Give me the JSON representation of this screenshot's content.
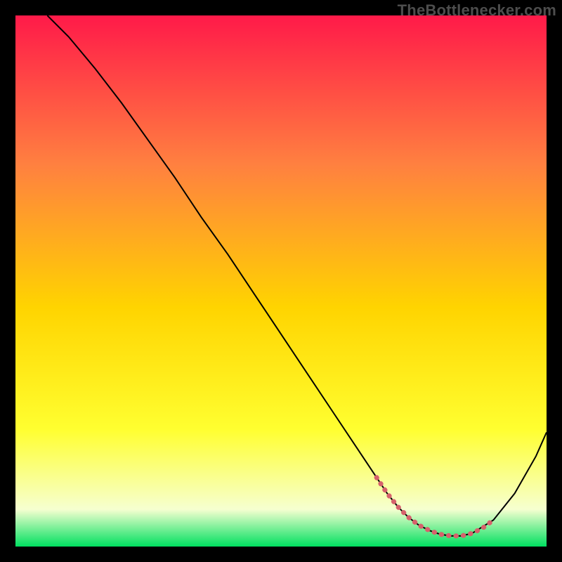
{
  "watermark": "TheBottlenecker.com",
  "chart_data": {
    "type": "line",
    "title": "",
    "xlabel": "",
    "ylabel": "",
    "xlim": [
      0,
      100
    ],
    "ylim": [
      0,
      100
    ],
    "grid": false,
    "gradient": {
      "top": "#ff1a49",
      "upper_mid": "#ff8040",
      "mid": "#ffd400",
      "lower_mid": "#ffff30",
      "near_bottom": "#f6ffd0",
      "bottom": "#00e060"
    },
    "series": [
      {
        "name": "curve",
        "color": "#000000",
        "stroke_width": 2,
        "x": [
          6,
          10,
          15,
          20,
          25,
          30,
          35,
          40,
          45,
          50,
          55,
          60,
          65,
          68,
          70,
          72,
          74,
          76,
          78,
          80,
          82,
          84,
          86,
          90,
          94,
          98,
          100
        ],
        "y": [
          100,
          96,
          90,
          83.5,
          76.5,
          69.5,
          62,
          55,
          47.5,
          40,
          32.5,
          25,
          17.5,
          13,
          10,
          7.5,
          5.5,
          4,
          3,
          2.3,
          2,
          2,
          2.5,
          5,
          10,
          17,
          21.5
        ]
      },
      {
        "name": "highlight",
        "color": "#d6626c",
        "stroke_width": 7,
        "stroke_linecap": "round",
        "dash": "0.5 10",
        "x": [
          68,
          70,
          72,
          74,
          76,
          78,
          80,
          82,
          84,
          86,
          88,
          90
        ],
        "y": [
          13,
          10,
          7.5,
          5.5,
          4,
          3,
          2.3,
          2,
          2,
          2.5,
          3.5,
          5
        ]
      }
    ]
  }
}
